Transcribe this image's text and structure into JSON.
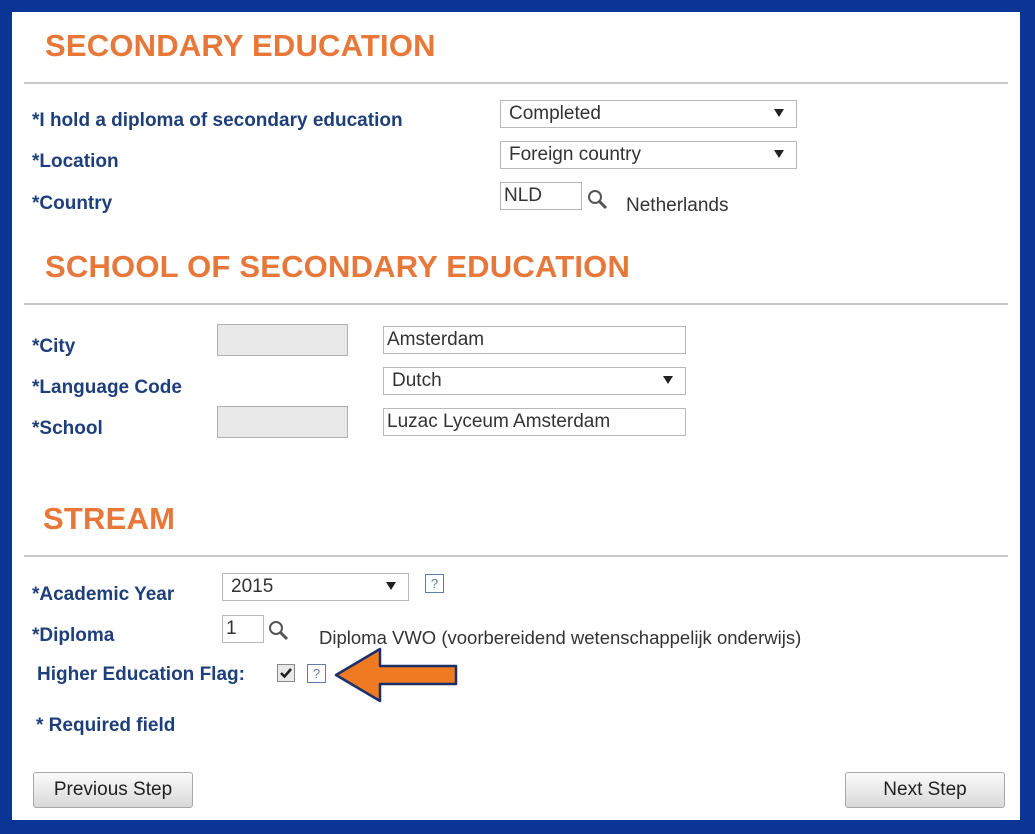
{
  "secondary": {
    "title": "SECONDARY EDUCATION",
    "diploma_label": "*I hold a diploma of secondary education",
    "diploma_value": "Completed",
    "location_label": "*Location",
    "location_value": "Foreign country",
    "country_label": "*Country",
    "country_code": "NLD",
    "country_name": "Netherlands"
  },
  "school": {
    "title": "SCHOOL OF SECONDARY EDUCATION",
    "city_label": "*City",
    "city_value": "Amsterdam",
    "language_label": "*Language Code",
    "language_value": "Dutch",
    "school_label": "*School",
    "school_value": "Luzac Lyceum Amsterdam"
  },
  "stream": {
    "title": "STREAM",
    "year_label": "*Academic Year",
    "year_value": "2015",
    "diploma_label": "*Diploma",
    "diploma_code": "1",
    "diploma_desc": "Diploma VWO (voorbereidend wetenschappelijk onderwijs)",
    "flag_label": "Higher Education Flag:",
    "flag_checked": true,
    "help_glyph": "?"
  },
  "required_note": "* Required field",
  "buttons": {
    "previous": "Previous Step",
    "next": "Next Step"
  },
  "colors": {
    "heading": "#e8773a",
    "label": "#1f3f7a",
    "frame": "#0a3594",
    "arrow": "#f07a21"
  },
  "icons": [
    "search-icon",
    "help-icon",
    "checkbox-icon",
    "arrow-indicator-icon",
    "dropdown-arrow-icon"
  ]
}
